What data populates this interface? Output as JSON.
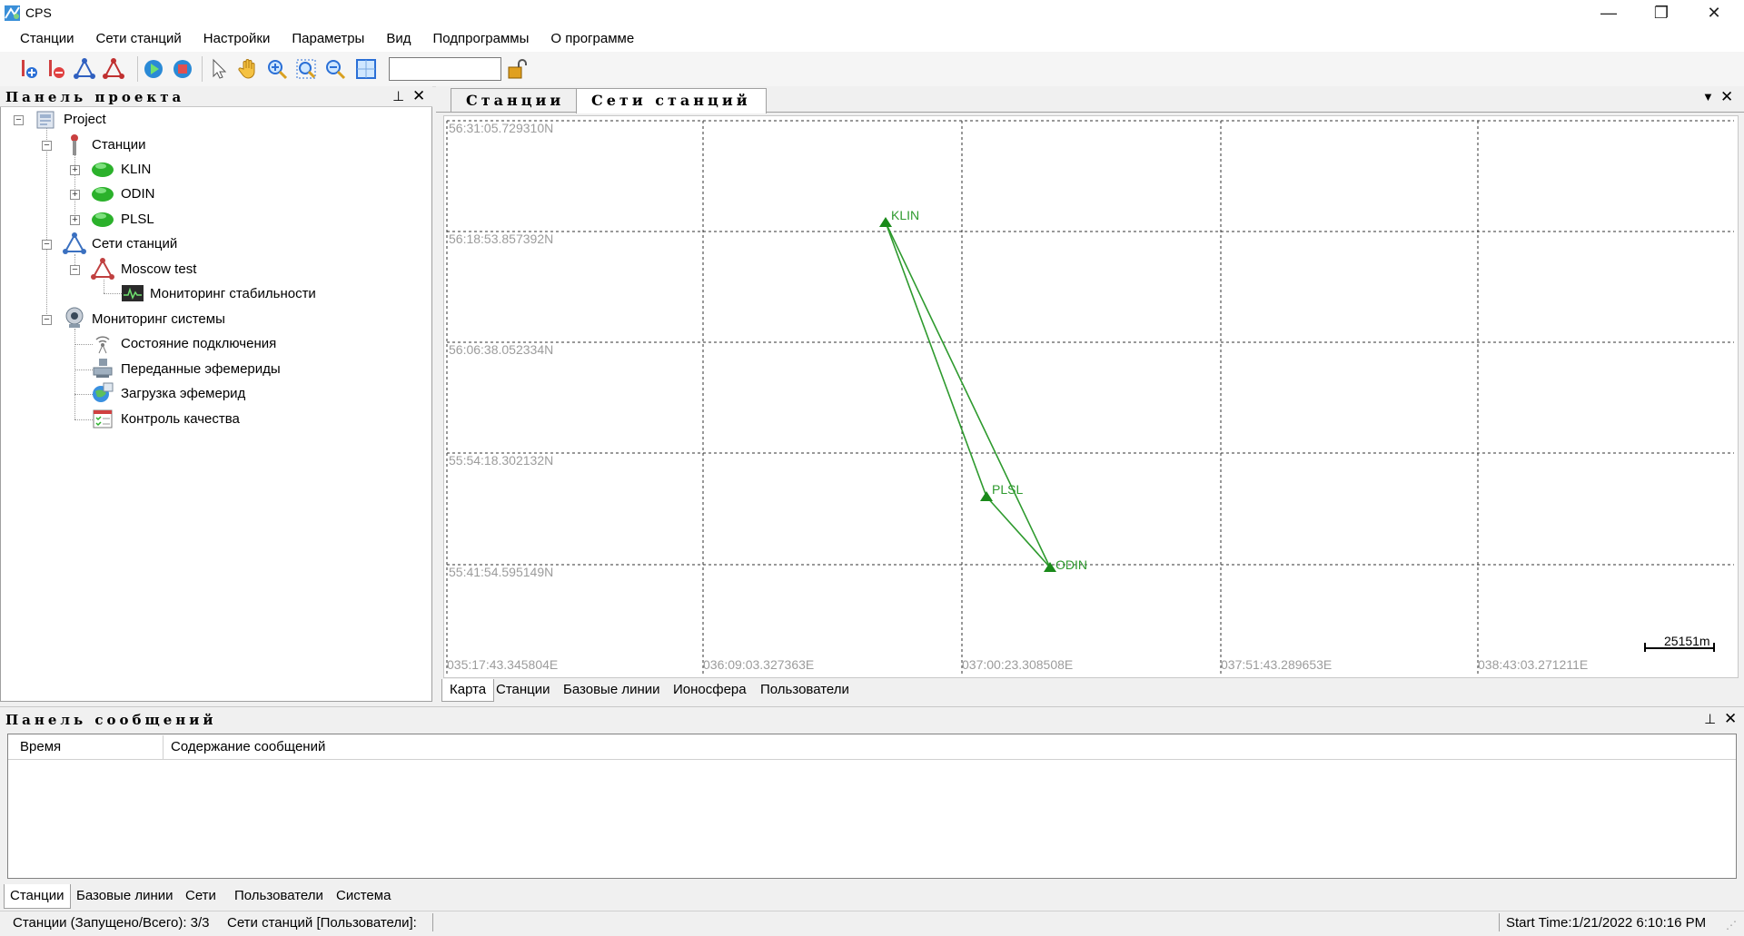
{
  "window": {
    "title": "CPS",
    "minimize": "—",
    "restore": "❐",
    "close": "✕"
  },
  "menu": [
    "Станции",
    "Сети станций",
    "Настройки",
    "Параметры",
    "Вид",
    "Подпрограммы",
    "О программе"
  ],
  "toolbar": {
    "input_value": ""
  },
  "project_panel": {
    "title": "Панель проекта",
    "tree": {
      "root": "Project",
      "stations_group": "Станции",
      "stations": [
        "KLIN",
        "ODIN",
        "PLSL"
      ],
      "networks_group": "Сети станций",
      "network": "Moscow test",
      "network_child": "Мониторинг стабильности",
      "monitoring_group": "Мониторинг системы",
      "monitoring_items": [
        "Состояние подключения",
        "Переданные эфемериды",
        "Загрузка эфемерид",
        "Контроль качества"
      ]
    }
  },
  "doc_tabs": [
    "Станции",
    "Сети станций"
  ],
  "map": {
    "lat_labels": [
      "56:31:05.729310N",
      "56:18:53.857392N",
      "56:06:38.052334N",
      "55:54:18.302132N",
      "55:41:54.595149N"
    ],
    "lon_labels": [
      "035:17:43.345804E",
      "036:09:03.327363E",
      "037:00:23.308508E",
      "037:51:43.289653E",
      "038:43:03.271211E"
    ],
    "stations": [
      "KLIN",
      "PLSL",
      "ODIN"
    ],
    "scale": "25151m",
    "station_color": "#1a8a1a"
  },
  "map_bottom_tabs": [
    "Карта",
    "Станции",
    "Базовые линии",
    "Ионосфера",
    "Пользователи"
  ],
  "messages_panel": {
    "title": "Панель сообщений",
    "columns": [
      "Время",
      "Содержание сообщений"
    ],
    "tabs": [
      "Станции",
      "Базовые линии",
      "Сети",
      "Пользователи",
      "Система"
    ]
  },
  "status": {
    "left": "Станции (Запущено/Всего): 3/3",
    "networks": "Сети станций [Пользователи]:",
    "right": "Start Time:1/21/2022 6:10:16 PM"
  }
}
